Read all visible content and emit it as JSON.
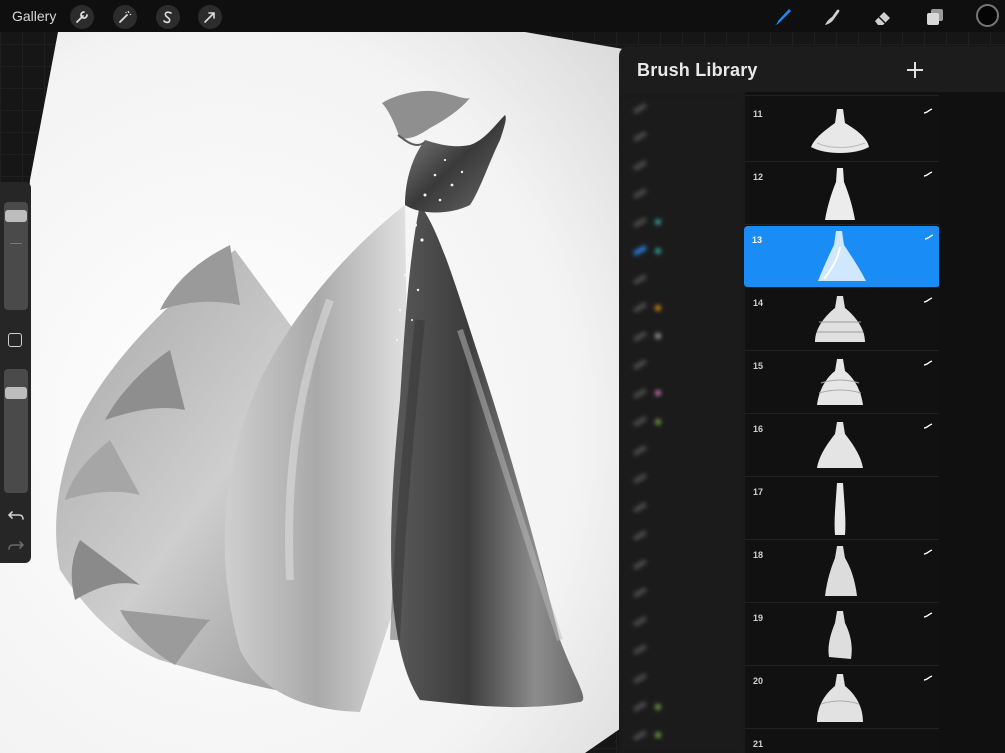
{
  "topbar": {
    "gallery_label": "Gallery",
    "tools": [
      {
        "name": "wrench-icon"
      },
      {
        "name": "magic-wand-icon"
      },
      {
        "name": "selection-s-icon"
      },
      {
        "name": "transform-arrow-icon"
      }
    ],
    "right_tools": [
      {
        "name": "brush-icon",
        "active": true
      },
      {
        "name": "smudge-icon"
      },
      {
        "name": "eraser-icon"
      },
      {
        "name": "layers-icon"
      },
      {
        "name": "color-well"
      }
    ],
    "accent_color": "#1a8cf5"
  },
  "sidebar": {
    "brush_size_level": 0.75,
    "opacity_level": 0.82
  },
  "brush_library": {
    "title": "Brush Library",
    "add_button": "+",
    "selected_number": "13",
    "brushes": [
      {
        "number": "11"
      },
      {
        "number": "12"
      },
      {
        "number": "13"
      },
      {
        "number": "14"
      },
      {
        "number": "15"
      },
      {
        "number": "16"
      },
      {
        "number": "17"
      },
      {
        "number": "18"
      },
      {
        "number": "19"
      },
      {
        "number": "20"
      },
      {
        "number": "21"
      }
    ]
  }
}
